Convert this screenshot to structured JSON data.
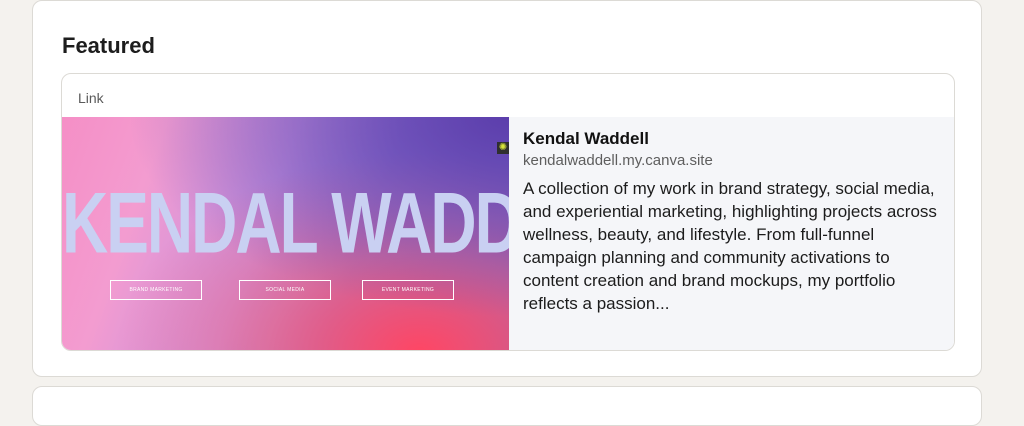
{
  "section": {
    "title": "Featured"
  },
  "featured": {
    "type_label": "Link",
    "preview": {
      "heading": "KENDAL WADDELL",
      "buttons": [
        "BRAND MARKETING",
        "SOCIAL MEDIA",
        "EVENT MARKETING"
      ]
    },
    "title": "Kendal Waddell",
    "url": "kendalwaddell.my.canva.site",
    "description": "A collection of my work in brand strategy, social media, and experiential marketing, highlighting projects across wellness, beauty, and lifestyle. From full-funnel campaign planning and community activations to content creation and brand mockups, my portfolio reflects a passion..."
  },
  "colors": {
    "card_bg": "#ffffff",
    "page_bg": "#f4f2ee",
    "info_bg": "#f5f6f9"
  },
  "icons": {
    "sparkle": "sparkle-icon"
  }
}
